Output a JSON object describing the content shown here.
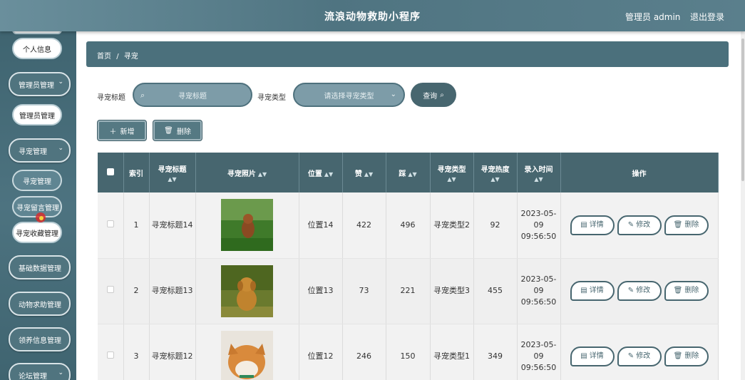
{
  "header": {
    "title": "流浪动物救助小程序",
    "user": "管理员 admin",
    "logout": "退出登录"
  },
  "sidebar": {
    "items": [
      {
        "label": "个人信息"
      },
      {
        "label": "管理员管理"
      },
      {
        "label": "管理员管理"
      },
      {
        "label": "寻宠管理"
      },
      {
        "label": "寻宠管理"
      },
      {
        "label": "寻宠留言管理"
      },
      {
        "label": "寻宠收藏管理"
      },
      {
        "label": "基础数据管理"
      },
      {
        "label": "动物求助管理"
      },
      {
        "label": "领养信息管理"
      },
      {
        "label": "论坛管理"
      }
    ],
    "chevron": "⌄"
  },
  "breadcrumb": {
    "home": "首页",
    "separator": "/",
    "current": "寻宠"
  },
  "search": {
    "title_label": "寻宠标题",
    "title_placeholder": "寻宠标题",
    "type_label": "寻宠类型",
    "type_placeholder": "请选择寻宠类型",
    "query_button": "查询"
  },
  "actions": {
    "add": "新增",
    "delete": "删除"
  },
  "table": {
    "headers": [
      "索引",
      "寻宠标题",
      "寻宠照片",
      "位置",
      "赞",
      "踩",
      "寻宠类型",
      "寻宠热度",
      "录入时间",
      "操作"
    ],
    "row_buttons": {
      "detail": "详情",
      "edit": "修改",
      "delete": "删除"
    },
    "rows": [
      {
        "index": "1",
        "title": "寻宠标题14",
        "location": "位置14",
        "likes": "422",
        "dislikes": "496",
        "type": "寻宠类型2",
        "heat": "92",
        "time": "2023-05-09 09:56:50"
      },
      {
        "index": "2",
        "title": "寻宠标题13",
        "location": "位置13",
        "likes": "73",
        "dislikes": "221",
        "type": "寻宠类型3",
        "heat": "455",
        "time": "2023-05-09 09:56:50"
      },
      {
        "index": "3",
        "title": "寻宠标题12",
        "location": "位置12",
        "likes": "246",
        "dislikes": "150",
        "type": "寻宠类型1",
        "heat": "349",
        "time": "2023-05-09 09:56:50"
      }
    ]
  },
  "colors": {
    "header": "#5a7f8c",
    "sidebar": "#46697a",
    "accent": "#47666f"
  }
}
